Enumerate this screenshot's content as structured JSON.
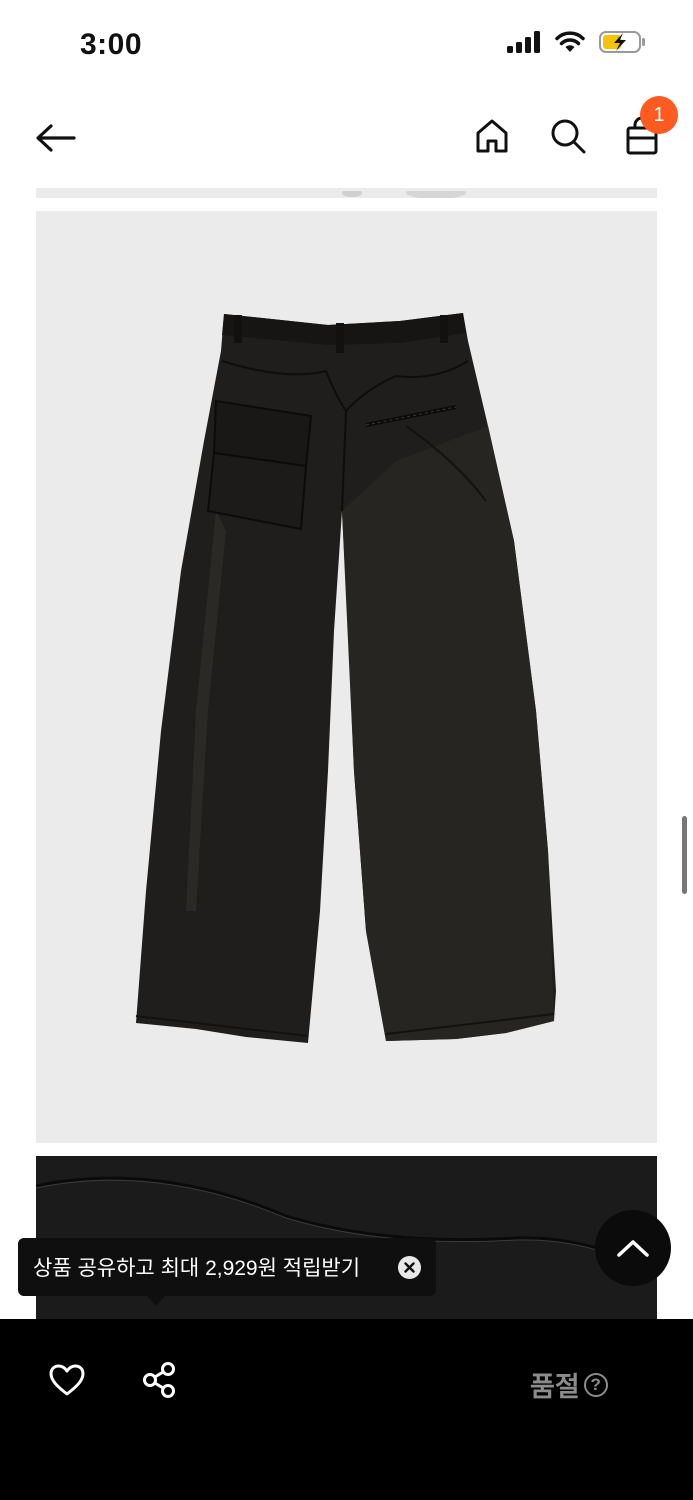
{
  "status_bar": {
    "time": "3:00"
  },
  "header": {
    "cart_count": "1"
  },
  "tooltip": {
    "text": "상품 공유하고 최대 2,929원 적립받기"
  },
  "bottom_bar": {
    "status_label": "품절",
    "help_glyph": "?"
  },
  "icons": {
    "back": "arrow-left-icon",
    "home": "home-icon",
    "search": "search-icon",
    "cart": "shopping-bag-icon",
    "like": "heart-icon",
    "share": "share-icon",
    "scroll_top": "chevron-up-icon",
    "close": "close-icon"
  },
  "colors": {
    "badge": "#ff5a1f",
    "image_background": "#ebebeb",
    "bottom_bar": "#000000",
    "soldout_text": "#8c8c8c"
  }
}
